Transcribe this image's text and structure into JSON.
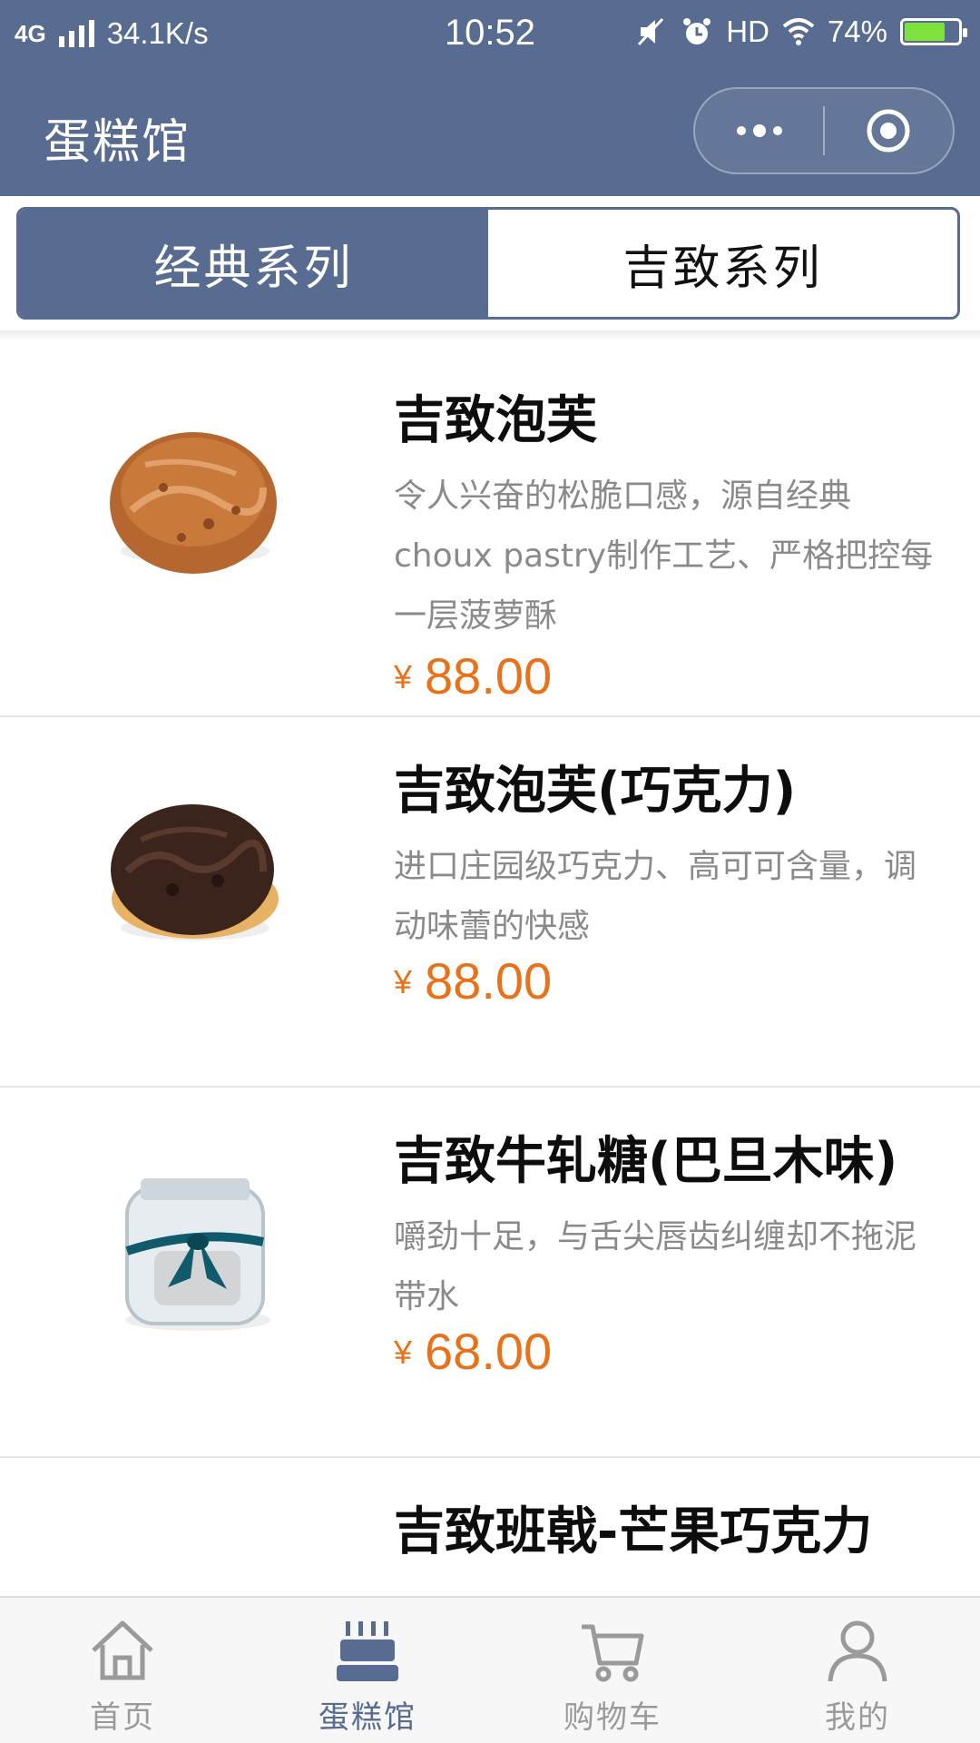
{
  "status_bar": {
    "network": "4G",
    "speed": "34.1K/s",
    "time": "10:52",
    "hd": "HD",
    "battery_percent": "74%",
    "battery_level": 0.74
  },
  "header": {
    "title": "蛋糕馆",
    "more_icon": "ellipsis-icon",
    "close_icon": "target-circle-icon"
  },
  "segments": [
    {
      "label": "经典系列",
      "active": true
    },
    {
      "label": "吉致系列",
      "active": false
    }
  ],
  "products": [
    {
      "name": "吉致泡芙",
      "description": "令人兴奋的松脆口感，源自经典choux pastry制作工艺、严格把控每一层菠萝酥",
      "currency": "¥",
      "price": "88.00",
      "image": "cream-puff-image"
    },
    {
      "name": "吉致泡芙(巧克力)",
      "description": "进口庄园级巧克力、高可可含量，调动味蕾的快感",
      "currency": "¥",
      "price": "88.00",
      "image": "chocolate-puff-image"
    },
    {
      "name": "吉致牛轧糖(巴旦木味)",
      "description": "嚼劲十足，与舌尖唇齿纠缠却不拖泥带水",
      "currency": "¥",
      "price": "68.00",
      "image": "nougat-jar-image"
    },
    {
      "name": "吉致班戟-芒果巧克力",
      "description": "",
      "currency": "",
      "price": "",
      "image": ""
    }
  ],
  "tabbar": [
    {
      "label": "首页",
      "icon": "home-icon",
      "active": false
    },
    {
      "label": "蛋糕馆",
      "icon": "cake-icon",
      "active": true
    },
    {
      "label": "购物车",
      "icon": "cart-icon",
      "active": false
    },
    {
      "label": "我的",
      "icon": "user-icon",
      "active": false
    }
  ],
  "colors": {
    "primary": "#586c91",
    "price": "#e8711a",
    "description": "#8a8a8a",
    "tab_inactive": "#9a9a9a"
  }
}
